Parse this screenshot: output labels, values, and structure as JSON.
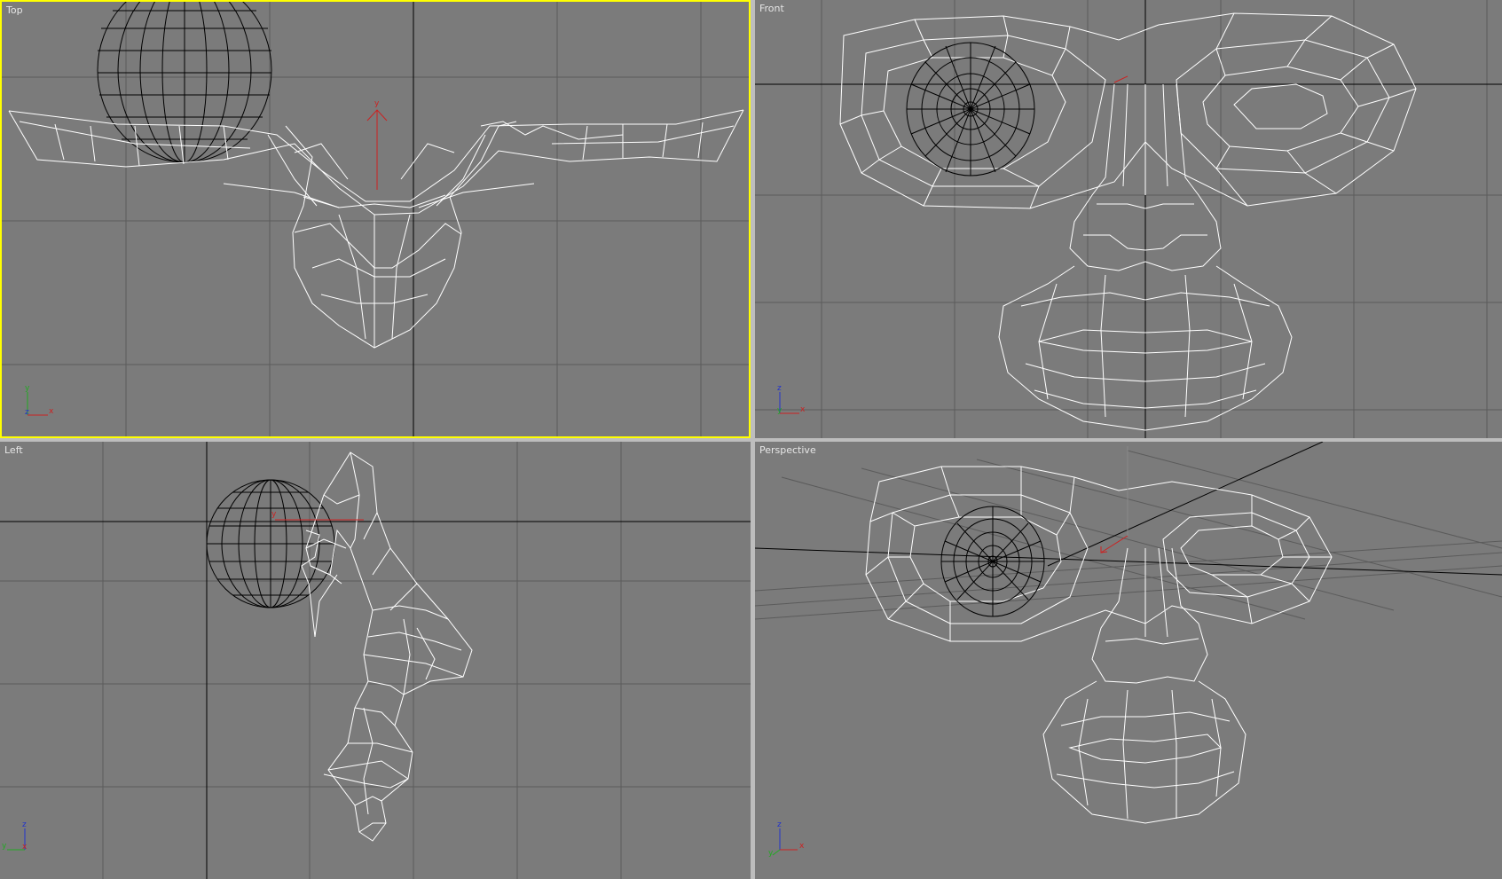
{
  "viewports": {
    "top": {
      "label": "Top",
      "active": true
    },
    "front": {
      "label": "Front"
    },
    "left": {
      "label": "Left"
    },
    "perspective": {
      "label": "Perspective"
    }
  },
  "axis_labels": {
    "x": "x",
    "y": "y",
    "z": "z"
  },
  "colors": {
    "viewport_bg": "#7b7b7b",
    "grid": "#5b5b5b",
    "active_border": "#ffff00",
    "wireframe": "#ffffff",
    "eyeball": "#000000",
    "axis_x": "#cc2222",
    "axis_y": "#22aa22",
    "axis_z": "#2233cc"
  },
  "icons": [
    "axis-tripod-icon",
    "gizmo-icon"
  ]
}
